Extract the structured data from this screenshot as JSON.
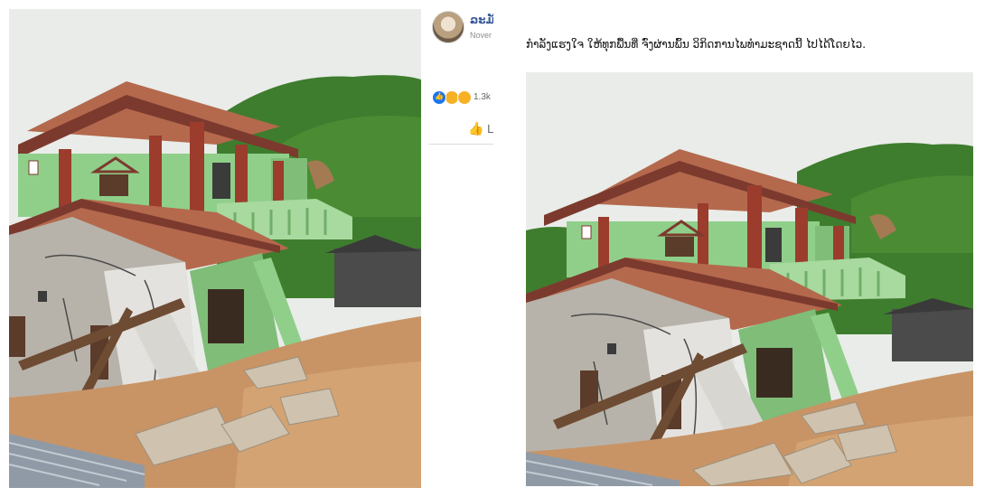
{
  "post": {
    "poster_name": "ລະມັ",
    "date": "Nover",
    "reaction_count": "1.3k",
    "like_label": "L"
  },
  "caption": "ກຳລັງແຮງໃຈ ໃຫ້ທຸກພື້ນທີ່ ຈົ່ງຜ່ານພົ້ນ ວິກິດການໄພທຳມະຊາດນີ້ ໄປໄດ້ໂດຍໄວ.",
  "icons": {
    "avatar": "profile-photo",
    "reactions": [
      "like-icon",
      "sad-icon",
      "wow-icon"
    ],
    "like_action": "thumbs-up-icon"
  },
  "colors": {
    "name_blue": "#385898",
    "like_blue": "#1877f2",
    "meta_gray": "#65676b",
    "wall_green": "#8fcf8a",
    "roof_brown": "#b4694d",
    "mud": "#c89466",
    "hill_green": "#3e7d2d"
  }
}
